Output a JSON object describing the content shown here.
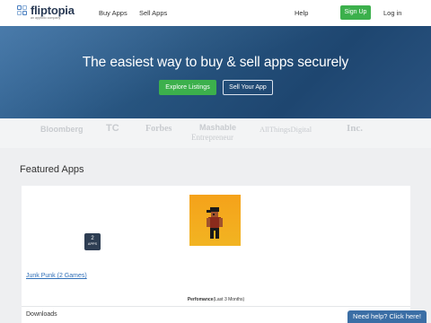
{
  "nav": {
    "logo_text": "fliptopia",
    "logo_sub": "an appfolio company",
    "buy_apps": "Buy Apps",
    "sell_apps": "Sell Apps",
    "help": "Help",
    "sign_up": "Sign Up",
    "log_in": "Log in"
  },
  "hero": {
    "title": "The easiest way to buy & sell apps securely",
    "explore": "Explore Listings",
    "sell": "Sell Your App"
  },
  "press": {
    "bloomberg": "Bloomberg",
    "techcrunch": "TC",
    "forbes": "Forbes",
    "mashable": "Mashable",
    "entrepreneur": "Entrepreneur",
    "allthingsd": "AllThingsDigital",
    "inc": "Inc."
  },
  "featured": {
    "title": "Featured Apps",
    "badge_count": "2",
    "badge_label": "APPS",
    "app_link": "Junk Punk (2 Games)",
    "performance_label": "Perfomance",
    "performance_period": "(Last 3 Months)",
    "downloads": "Downloads"
  },
  "help_button": "Need help? Click here!",
  "colors": {
    "accent_green": "#3cb04c",
    "hero_blue": "#27547f",
    "link_blue": "#2f6fb8",
    "badge_navy": "#2e3e53"
  }
}
